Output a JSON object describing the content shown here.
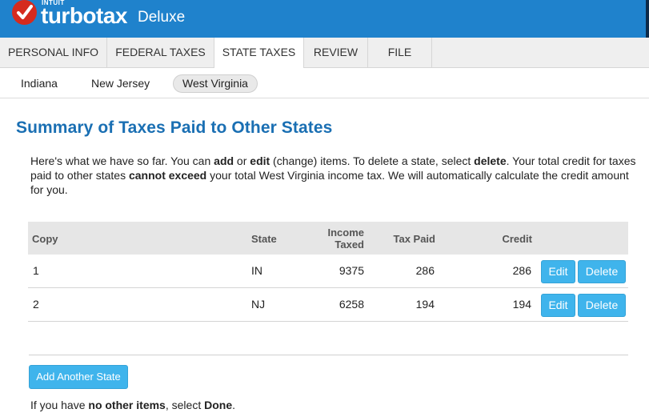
{
  "app": {
    "intuit": "INTUIT",
    "brand": "turbotax",
    "edition": "Deluxe"
  },
  "tabs": [
    {
      "label": "PERSONAL INFO"
    },
    {
      "label": "FEDERAL TAXES"
    },
    {
      "label": "STATE TAXES",
      "active": true
    },
    {
      "label": "REVIEW"
    },
    {
      "label": "FILE"
    }
  ],
  "states": [
    {
      "label": "Indiana"
    },
    {
      "label": "New Jersey"
    },
    {
      "label": "West Virginia",
      "active": true
    }
  ],
  "page": {
    "title": "Summary of Taxes Paid to Other States",
    "intro": {
      "t1": "Here's what we have so far. You can ",
      "b1": "add",
      "t2": " or ",
      "b2": "edit",
      "t3": " (change) items. To delete a state, select ",
      "b3": "delete",
      "t4": ". Your total credit for taxes paid to other states ",
      "b4": "cannot exceed",
      "t5": " your total West Virginia income tax. We will automatically calculate the credit amount for you."
    }
  },
  "table": {
    "headers": {
      "copy": "Copy",
      "state": "State",
      "income_l1": "Income",
      "income_l2": "Taxed",
      "tax_paid": "Tax Paid",
      "credit": "Credit"
    },
    "rows": [
      {
        "copy": "1",
        "state": "IN",
        "income": "9375",
        "tax_paid": "286",
        "credit": "286",
        "edit": "Edit",
        "delete": "Delete"
      },
      {
        "copy": "2",
        "state": "NJ",
        "income": "6258",
        "tax_paid": "194",
        "credit": "194",
        "edit": "Edit",
        "delete": "Delete"
      }
    ]
  },
  "actions": {
    "add_state": "Add Another State"
  },
  "footer": {
    "t1": "If you have ",
    "b1": "no other items",
    "t2": ", select ",
    "b2": "Done",
    "t3": "."
  },
  "colors": {
    "header_blue": "#1f82cc",
    "title_blue": "#1a6fb3",
    "button_blue": "#3fb4ec",
    "logo_red": "#d52b1e"
  },
  "icons": {
    "logo": "checkmark-icon"
  }
}
